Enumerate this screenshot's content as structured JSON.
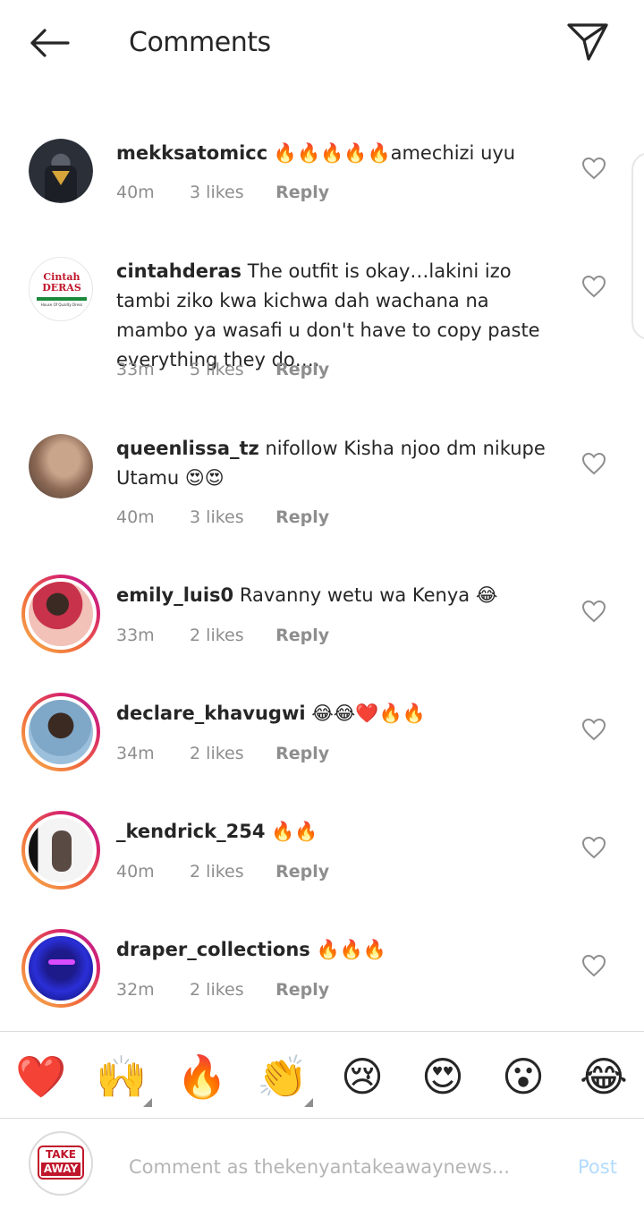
{
  "header": {
    "title": "Comments",
    "back_icon": "arrow-left-icon",
    "share_icon": "paper-plane-icon"
  },
  "comments": [
    {
      "username": "mekksatomicc",
      "text": "🔥🔥🔥🔥🔥amechizi uyu",
      "time": "40m",
      "likes": "3 likes",
      "reply": "Reply"
    },
    {
      "username": "cintahderas",
      "text": "The outfit is okay…lakini izo tambi ziko kwa kichwa dah wachana na mambo ya wasafi u don't have to copy paste everything they do….",
      "time": "33m",
      "likes": "5 likes",
      "reply": "Reply"
    },
    {
      "username": "queenlissa_tz",
      "text": "nifollow Kisha njoo dm nikupe Utamu 😍😍",
      "time": "40m",
      "likes": "3 likes",
      "reply": "Reply"
    },
    {
      "username": "emily_luis0",
      "text": "Ravanny wetu wa Kenya 😂",
      "time": "33m",
      "likes": "2 likes",
      "reply": "Reply"
    },
    {
      "username": "declare_khavugwi",
      "text": "😂😂❤️🔥🔥",
      "time": "34m",
      "likes": "2 likes",
      "reply": "Reply"
    },
    {
      "username": "_kendrick_254",
      "text": "🔥🔥",
      "time": "40m",
      "likes": "2 likes",
      "reply": "Reply"
    },
    {
      "username": "draper_collections",
      "text": "🔥🔥🔥",
      "time": "32m",
      "likes": "2 likes",
      "reply": "Reply"
    }
  ],
  "avatar_logo": {
    "cintah": "Cintah DERAS",
    "cintah_tagline": "House Of Quality Dress",
    "takeaway_line1": "TAKE",
    "takeaway_line2": "AWAY"
  },
  "reactions": [
    "❤️",
    "🙌",
    "🔥",
    "👏",
    "😢",
    "😍",
    "😮",
    "😂"
  ],
  "composer": {
    "placeholder": "Comment as thekenyantakeawaynews...",
    "post_label": "Post"
  },
  "colors": {
    "accent_blue_disabled": "#b3dbff",
    "meta_gray": "#8e8e8e",
    "text": "#262626"
  }
}
